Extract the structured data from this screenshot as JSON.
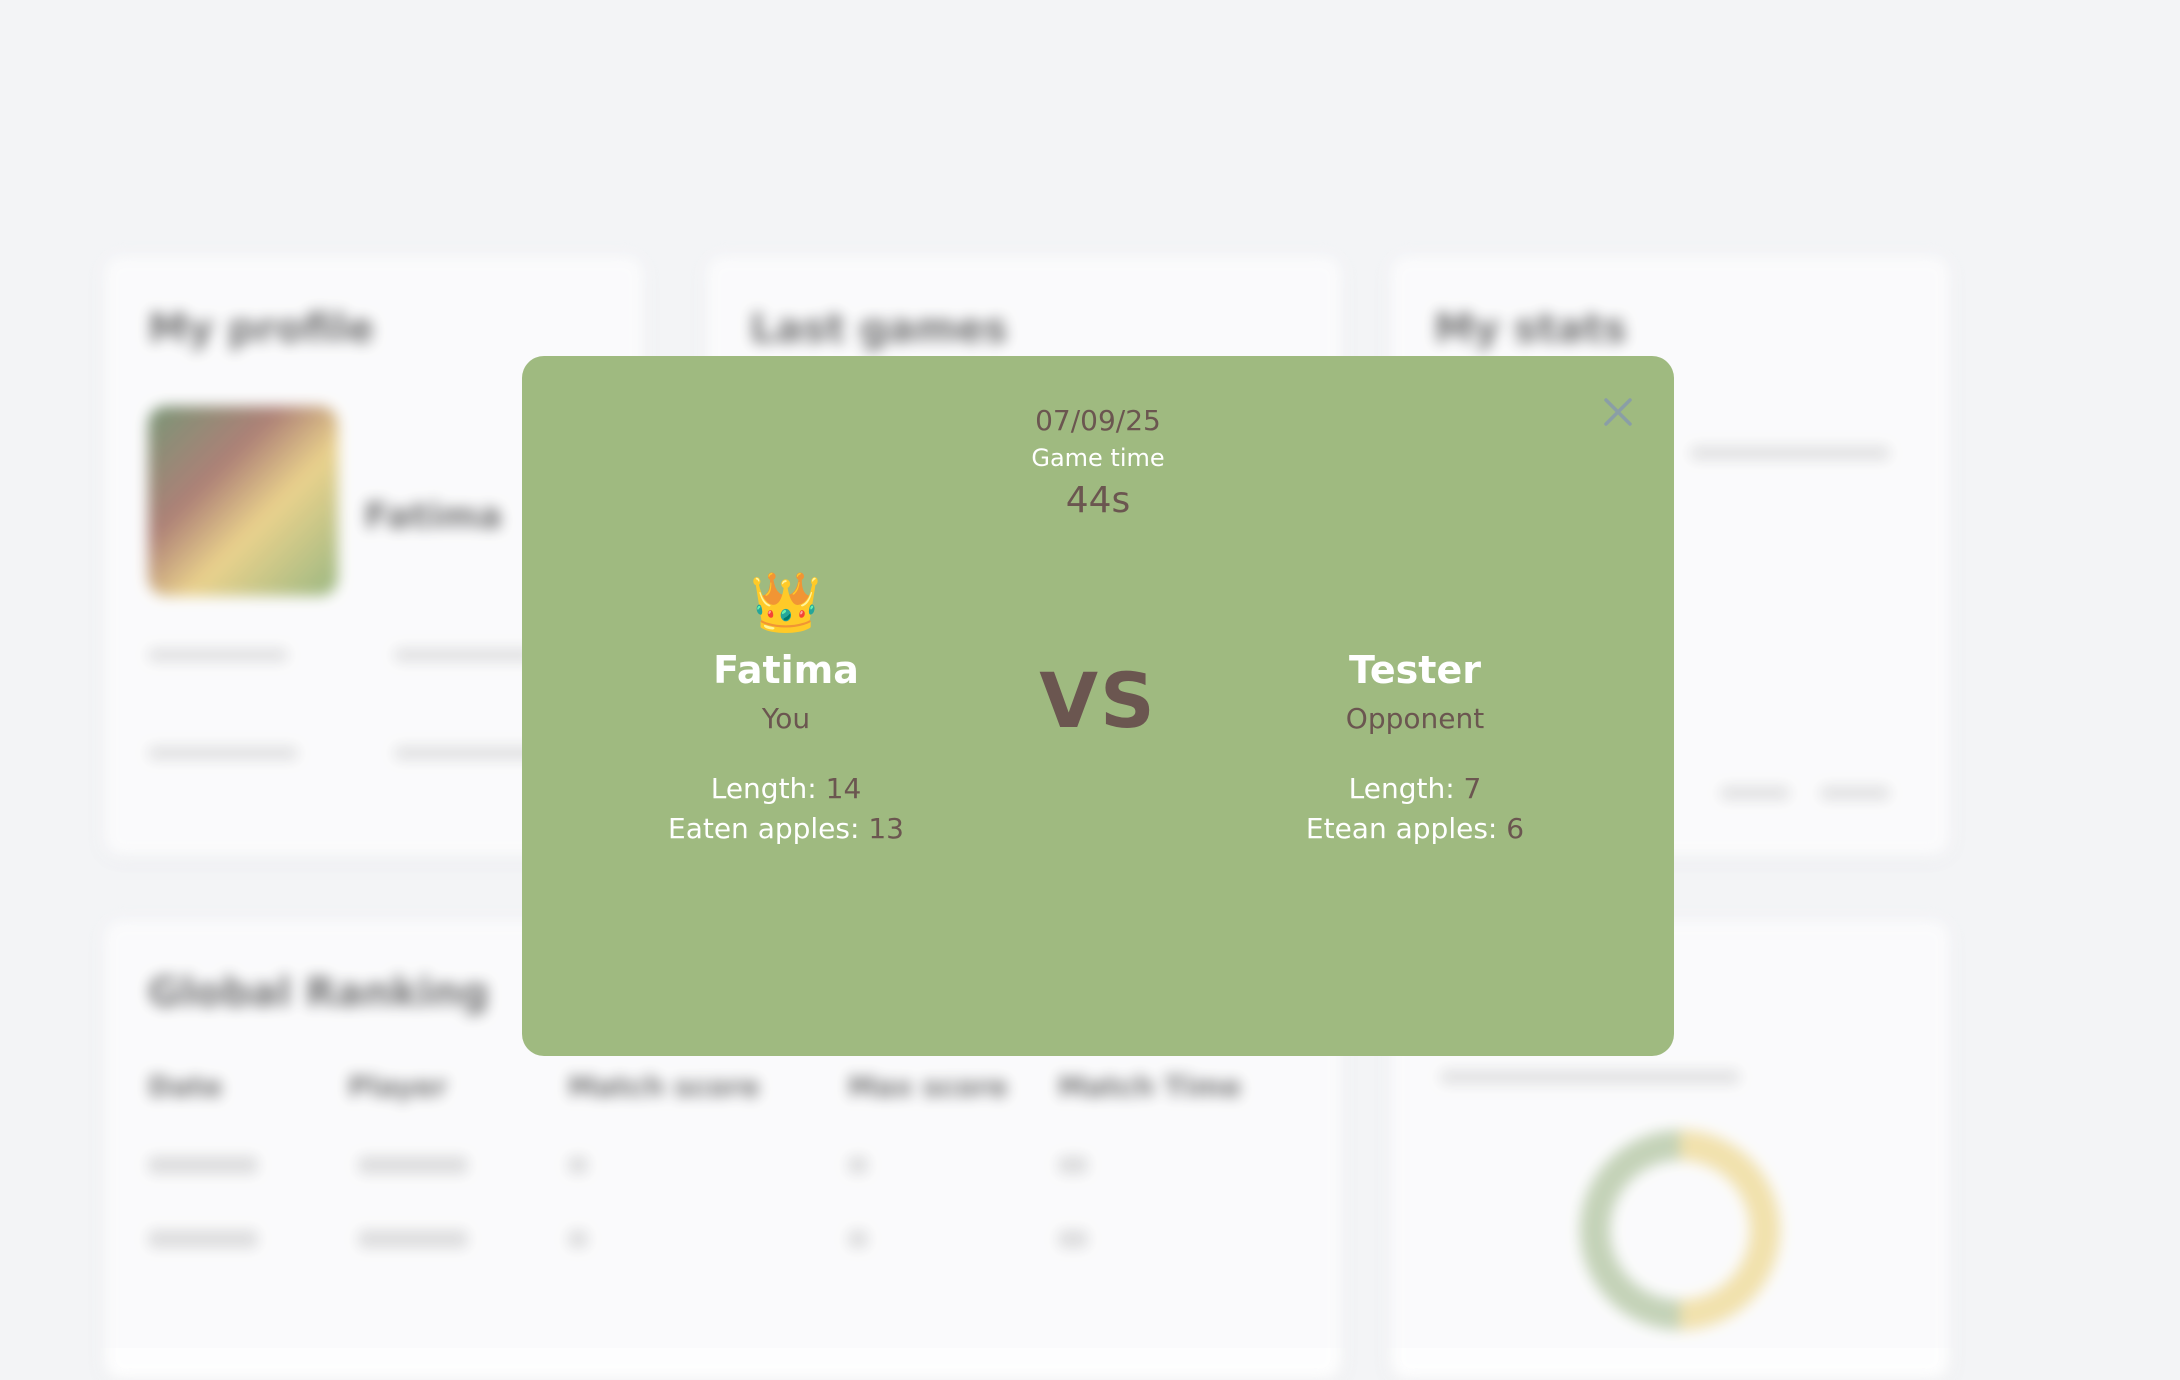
{
  "background": {
    "profile_title": "My profile",
    "profile_name": "Fatima",
    "last_games_title": "Last games",
    "stats_title": "My stats",
    "ranking_title": "Global Ranking",
    "ranking_headers": [
      "Date",
      "Player",
      "Match score",
      "Max score",
      "Match Time"
    ]
  },
  "modal": {
    "date": "07/09/25",
    "game_time_label": "Game time",
    "game_time_value": "44s",
    "vs_label": "VS",
    "close_icon": "close-icon",
    "player": {
      "crown": "👑",
      "name": "Fatima",
      "role": "You",
      "length_label": "Length:",
      "length_value": "14",
      "apples_label": "Eaten apples:",
      "apples_value": "13"
    },
    "opponent": {
      "name": "Tester",
      "role": "Opponent",
      "length_label": "Length:",
      "length_value": "7",
      "apples_label": "Etean apples:",
      "apples_value": "6"
    }
  },
  "colors": {
    "modal_bg": "#9fba80",
    "text_brown": "#6b5650",
    "text_white": "#ffffff",
    "page_bg": "#f3f4f6"
  }
}
